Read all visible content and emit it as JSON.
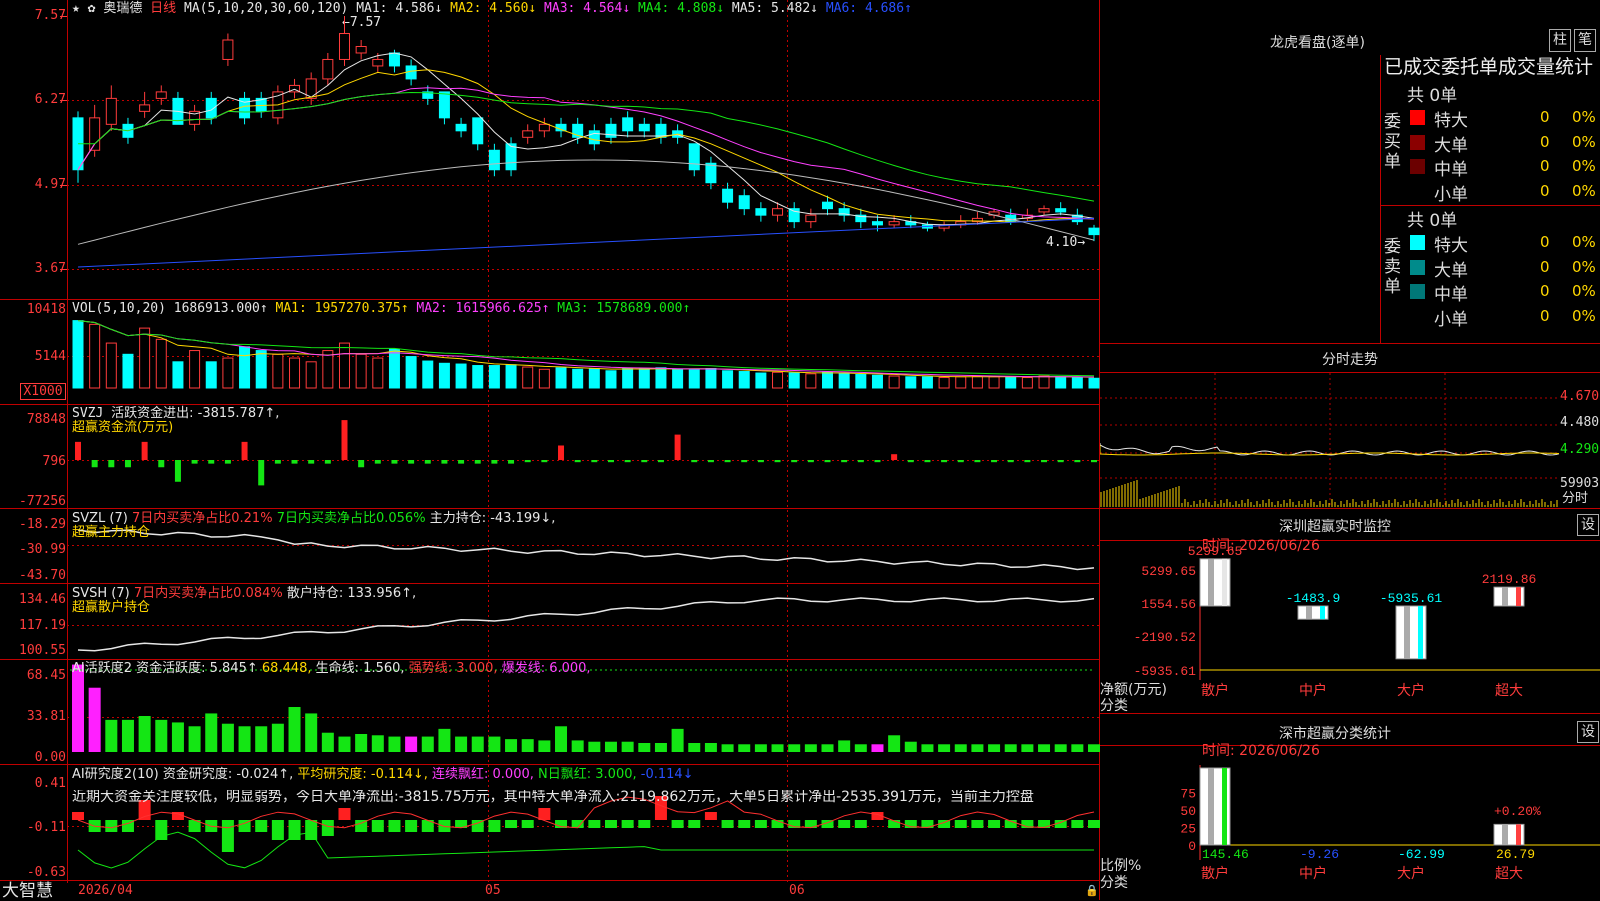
{
  "stock": {
    "name": "奥瑞德",
    "period": "日线",
    "marks": "★ ✿"
  },
  "price_axis": [
    "7.57",
    "6.27",
    "4.97",
    "3.67"
  ],
  "price_header": {
    "ma_label": "MA(5,10,20,30,60,120)",
    "ma1": "MA1: 4.586↓",
    "ma2": "MA2: 4.560↓",
    "ma3": "MA3: 4.564↓",
    "ma4": "MA4: 4.808↓",
    "ma5": "MA5: 5.482↓",
    "ma6": "MA6: 4.686↑"
  },
  "price_annotations": {
    "high": "7.57",
    "low": "4.10"
  },
  "vol": {
    "axis": [
      "10418",
      "5144",
      "X1000"
    ],
    "label": "VOL(5,10,20)",
    "value": "1686913.000↑",
    "ma1": "MA1: 1957270.375↑",
    "ma2": "MA2: 1615966.625↑",
    "ma3": "MA3: 1578689.000↑"
  },
  "svzj": {
    "axis": [
      "78848",
      "796",
      "-77256"
    ],
    "label": "SVZJ",
    "line": "活跃资金进出: -3815.787↑,",
    "subtitle": "超赢资金流(万元)"
  },
  "svzl": {
    "axis": [
      "-18.29",
      "-30.99",
      "-43.70"
    ],
    "label": "SVZL (7)",
    "buy7": "7日内买卖净占比0.21%",
    "buy7b": "7日内买卖净占比0.056%",
    "hold": "主力持仓: -43.199↓,",
    "subtitle": "超赢主力持仓"
  },
  "svsh": {
    "axis": [
      "134.46",
      "117.19",
      "100.55"
    ],
    "label": "SVSH (7)",
    "buy7": "7日内买卖净占比0.084%",
    "hold": "散户持仓: 133.956↑,",
    "subtitle": "超赢散户持仓"
  },
  "ai1": {
    "axis": [
      "68.45",
      "33.81",
      "0.00"
    ],
    "label": "AI活跃度2",
    "act": "资金活跃度: 5.845↑",
    "v2": "68.448,",
    "life": "生命线: 1.560,",
    "strong": "强势线: 3.000,",
    "burst": "爆发线: 6.000,"
  },
  "ai2": {
    "axis": [
      "0.41",
      "-0.11",
      "-0.63"
    ],
    "label": "AI研究度2(10)",
    "research": "资金研究度: -0.024↑,",
    "avg": "平均研究度: -0.114↓,",
    "red": "连续飘红: 0.000,",
    "nred": "N日飘红: 3.000,",
    "last": "-0.114↓",
    "comment": "近期大资金关注度较低，明显弱势，今日大单净流出:-3815.75万元，其中特大单净流入:2119.862万元，大单5日累计净出-2535.391万元，当前主力控盘"
  },
  "date_axis": [
    "2026/04",
    "05",
    "06"
  ],
  "brand": "大智慧",
  "panel_lhb": {
    "title": "龙虎看盘(逐单)",
    "btn1": "柱",
    "btn2": "笔",
    "header": "已成交委托单成交量统计",
    "buy_label": "委买单",
    "sell_label": "委卖单",
    "buy_total": "共 0单",
    "sell_total": "共 0单",
    "buy_rows": [
      {
        "name": "特大",
        "count": "0",
        "pct": "0%",
        "color": "#ff0000"
      },
      {
        "name": "大单",
        "count": "0",
        "pct": "0%",
        "color": "#8b0000"
      },
      {
        "name": "中单",
        "count": "0",
        "pct": "0%",
        "color": "#6b0000"
      },
      {
        "name": "小单",
        "count": "0",
        "pct": "0%",
        "color": "#000000"
      }
    ],
    "sell_rows": [
      {
        "name": "特大",
        "count": "0",
        "pct": "0%",
        "color": "#00ffff"
      },
      {
        "name": "大单",
        "count": "0",
        "pct": "0%",
        "color": "#008b8b"
      },
      {
        "name": "中单",
        "count": "0",
        "pct": "0%",
        "color": "#007878"
      },
      {
        "name": "小单",
        "count": "0",
        "pct": "0%",
        "color": "#000000"
      }
    ]
  },
  "panel_fs": {
    "title": "分时走势",
    "y": [
      "4.670",
      "4.480",
      "4.290"
    ],
    "vol": "59903",
    "sub": "分时"
  },
  "panel_sz": {
    "title": "深圳超赢实时监控",
    "set": "设",
    "time": "时间: 2026/06/26",
    "y": [
      "5299.65",
      "1554.56",
      "-2190.52",
      "-5935.61"
    ],
    "unit": "净额(万元)",
    "cls": "分类",
    "bars": [
      {
        "name": "散户",
        "value": "5299.65"
      },
      {
        "name": "中户",
        "value": "-1483.9"
      },
      {
        "name": "大户",
        "value": "-5935.61"
      },
      {
        "name": "超大",
        "value": "2119.86"
      }
    ]
  },
  "panel_sc": {
    "title": "深市超赢分类统计",
    "set": "设",
    "time": "时间: 2026/06/26",
    "y": [
      "75",
      "50",
      "25",
      "0"
    ],
    "unit": "比例%",
    "cls": "分类",
    "pct_label": "+0.20%",
    "bars": [
      {
        "name": "散户",
        "value": "145.46"
      },
      {
        "name": "中户",
        "value": "-9.26"
      },
      {
        "name": "大户",
        "value": "-62.99"
      },
      {
        "name": "超大",
        "value": "26.79"
      }
    ]
  },
  "colors": {
    "up": "#ff3c3c",
    "down": "#00ffff",
    "grid": "#b40000",
    "vol_grn": "#14e614"
  }
}
